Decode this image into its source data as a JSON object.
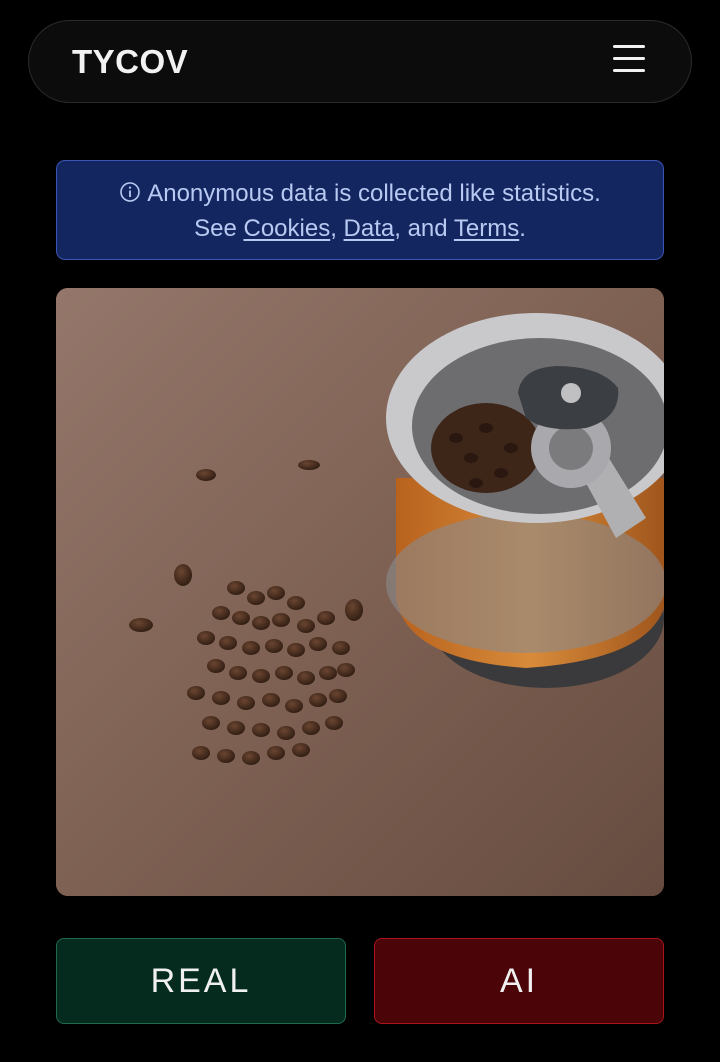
{
  "header": {
    "brand": "TYCOV",
    "menu_icon": "hamburger-menu-icon"
  },
  "notice": {
    "icon": "info-circle-icon",
    "line1": "Anonymous data is collected like statistics.",
    "see": "See ",
    "link_cookies": "Cookies",
    "sep1": ", ",
    "link_data": "Data",
    "sep2": ", and ",
    "link_terms": "Terms",
    "end": "."
  },
  "image": {
    "subject": "coffee beans and grinder"
  },
  "actions": {
    "real_label": "REAL",
    "ai_label": "AI"
  },
  "colors": {
    "background": "#000000",
    "notice_bg": "#14265f",
    "notice_text": "#b8c9f2",
    "real_bg": "#052b1f",
    "ai_bg": "#4b0508"
  }
}
